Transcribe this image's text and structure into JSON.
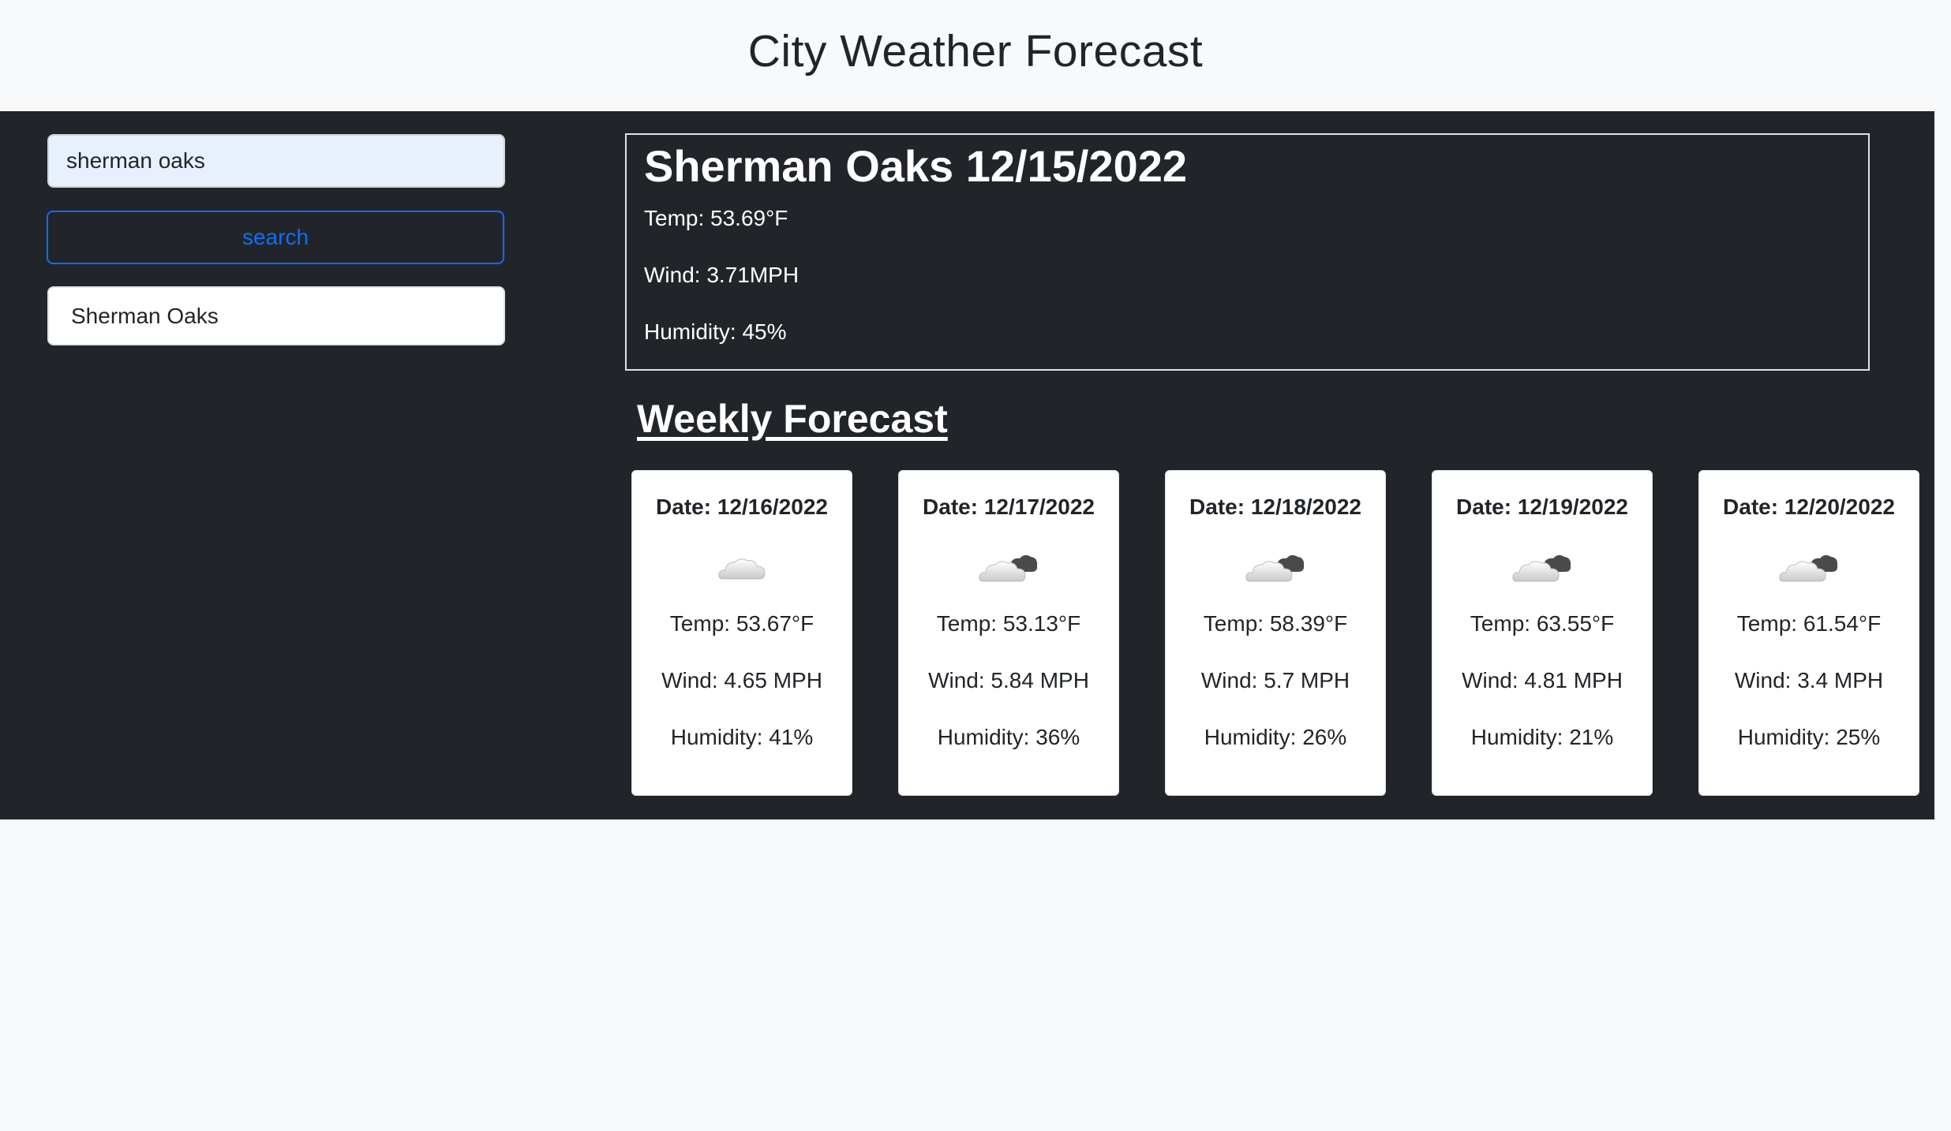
{
  "page_title": "City Weather Forecast",
  "search": {
    "value": "sherman oaks",
    "button_label": "search"
  },
  "history": [
    {
      "label": "Sherman Oaks"
    }
  ],
  "current": {
    "title": "Sherman Oaks 12/15/2022",
    "temp": "Temp: 53.69°F",
    "wind": "Wind: 3.71MPH",
    "humidity": "Humidity: 45%"
  },
  "weekly_title": "Weekly Forecast",
  "forecast": [
    {
      "date": "Date: 12/16/2022",
      "icon": "cloud-icon",
      "temp": "Temp: 53.67°F",
      "wind": "Wind: 4.65 MPH",
      "humidity": "Humidity: 41%"
    },
    {
      "date": "Date: 12/17/2022",
      "icon": "broken-clouds-icon",
      "temp": "Temp: 53.13°F",
      "wind": "Wind: 5.84 MPH",
      "humidity": "Humidity: 36%"
    },
    {
      "date": "Date: 12/18/2022",
      "icon": "broken-clouds-icon",
      "temp": "Temp: 58.39°F",
      "wind": "Wind: 5.7 MPH",
      "humidity": "Humidity: 26%"
    },
    {
      "date": "Date: 12/19/2022",
      "icon": "broken-clouds-icon",
      "temp": "Temp: 63.55°F",
      "wind": "Wind: 4.81 MPH",
      "humidity": "Humidity: 21%"
    },
    {
      "date": "Date: 12/20/2022",
      "icon": "broken-clouds-icon",
      "temp": "Temp: 61.54°F",
      "wind": "Wind: 3.4 MPH",
      "humidity": "Humidity: 25%"
    }
  ],
  "colors": {
    "panel_bg": "#212529",
    "page_bg": "#f8f9fa",
    "accent": "#0d6efd"
  }
}
